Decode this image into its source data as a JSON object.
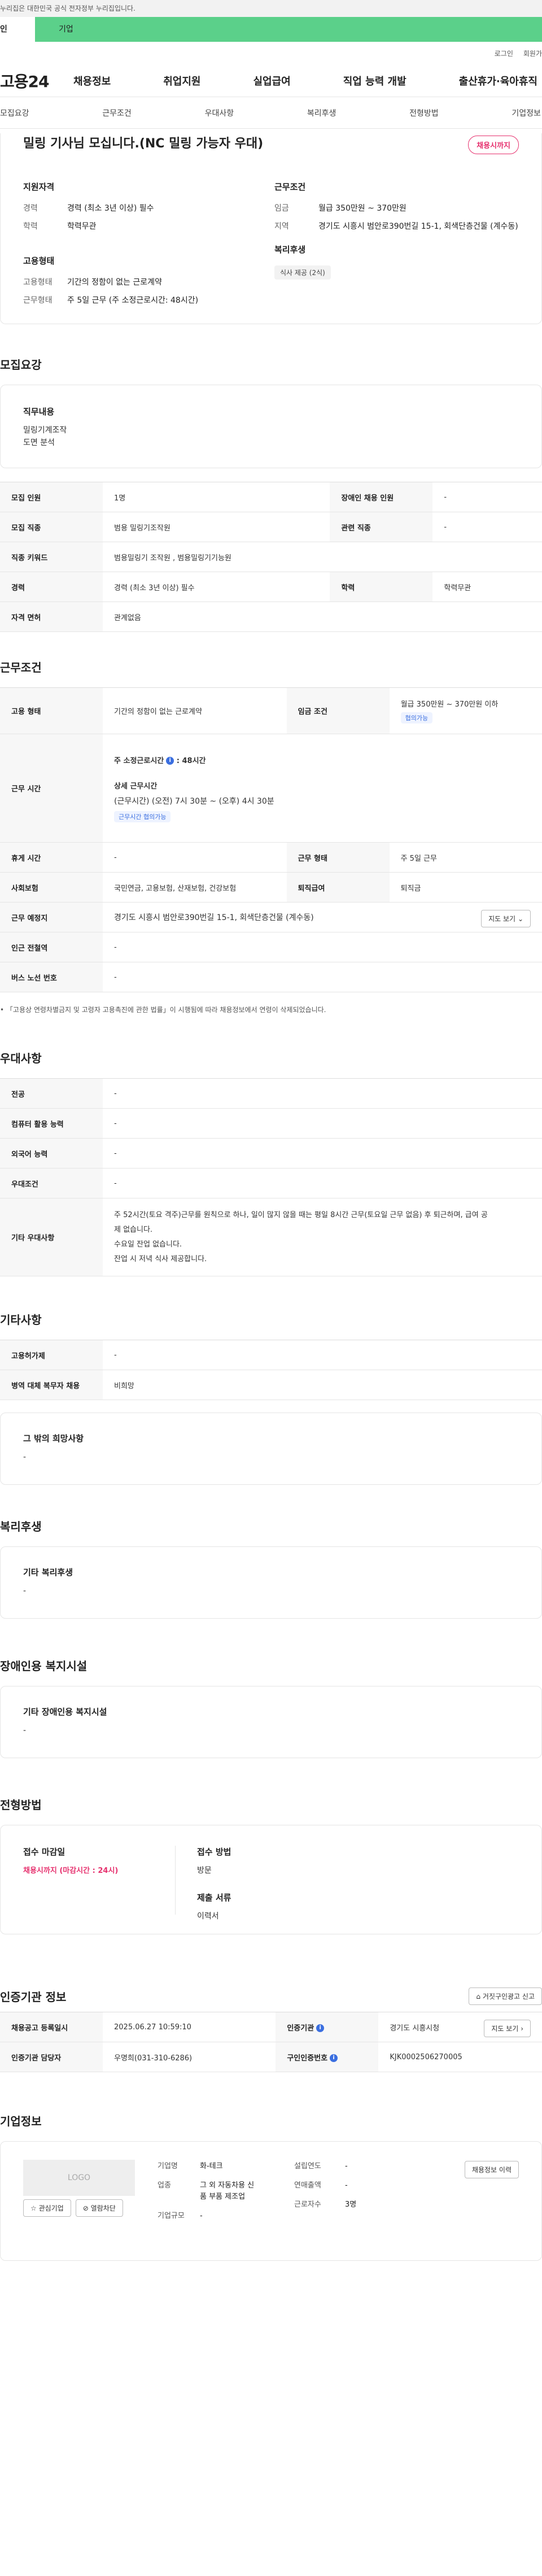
{
  "gov_banner": "누리집은 대한민국 공식 전자정부 누리집입니다.",
  "top_tabs": {
    "person": "인",
    "company": "기업"
  },
  "util": {
    "login": "로그인",
    "join": "회원가"
  },
  "logo": "고용24",
  "gnb": [
    "채용정보",
    "취업지원",
    "실업급여",
    "직업 능력 개발",
    "출산휴가·육아휴직"
  ],
  "anchors": [
    "모집요강",
    "근무조건",
    "우대사항",
    "복리후생",
    "전형방법",
    "기업정보"
  ],
  "summary": {
    "title": "밀링 기사님 모십니다.(NC 밀링 가능자 우대)",
    "dday": "채용시까지",
    "qual_h": "지원자격",
    "career_k": "경력",
    "career_v": "경력 (최소 3년 이상) 필수",
    "edu_k": "학력",
    "edu_v": "학력무관",
    "emp_h": "고용형태",
    "emp_k": "고용형태",
    "emp_v": "기간의 정함이 없는 근로계약",
    "work_k": "근무형태",
    "work_v": "주 5일 근무 (주 소정근로시간: 48시간)",
    "cond_h": "근무조건",
    "wage_k": "임금",
    "wage_v": "월급 350만원 ~ 370만원",
    "area_k": "지역",
    "area_v": "경기도 시흥시 범안로390번길 15-1, 회색단층건물 (계수동)",
    "welfare_h": "복리후생",
    "welfare_chip": "식사 제공 (2식)"
  },
  "recruit": {
    "title": "모집요강",
    "duty_h": "직무내용",
    "duty_lines": [
      "밀링기계조작",
      "도면 분석"
    ],
    "rows": {
      "count_k": "모집 인원",
      "count_v": "1명",
      "disabled_k": "장애인 채용 인원",
      "disabled_v": "-",
      "job_k": "모집 직종",
      "job_v": "범용 밀링기조작원",
      "related_k": "관련 직종",
      "related_v": "-",
      "kw_k": "직종 키워드",
      "kw_v": "범용밀링기 조작원 , 범용밀링기기능원",
      "career_k": "경력",
      "career_v": "경력 (최소 3년 이상) 필수",
      "edu_k": "학력",
      "edu_v": "학력무관",
      "license_k": "자격 면허",
      "license_v": "관계없음"
    }
  },
  "conditions": {
    "title": "근무조건",
    "emp_k": "고용 형태",
    "emp_v": "기간의 정함이 없는 근로계약",
    "wage_k": "임금 조건",
    "wage_v": "월급 350만원 ~ 370만원 이하",
    "wage_chip": "협의가능",
    "hours_k": "근무 시간",
    "weekly": "주 소정근로시간",
    "weekly_v": ": 48시간",
    "detail_h": "상세 근무시간",
    "detail_v": "(근무시간) (오전) 7시 30분 ~ (오후) 4시 30분",
    "detail_chip": "근무시간 협의가능",
    "holiday_k": "휴게 시간",
    "holiday_v": "-",
    "form_k": "근무 형태",
    "form_v": "주 5일 근무",
    "ins_k": "사회보험",
    "ins_v": "국민연금, 고용보험, 산재보험, 건강보험",
    "retire_k": "퇴직급여",
    "retire_v": "퇴직금",
    "place_k": "근무 예정지",
    "place_v": "경기도 시흥시 범안로390번길 15-1, 회색단층건물 (계수동)",
    "map_btn": "지도 보기",
    "station_k": "인근 전철역",
    "station_v": "-",
    "bus_k": "버스 노선 번호",
    "bus_v": "-",
    "note": "「고용상 연령차별금지 및 고령자 고용촉진에 관한 법률」이 시행됨에 따라 채용정보에서 연령이 삭제되었습니다."
  },
  "prefer": {
    "title": "우대사항",
    "major_k": "전공",
    "major_v": "-",
    "pc_k": "컴퓨터 활용 능력",
    "pc_v": "-",
    "lang_k": "외국어 능력",
    "lang_v": "-",
    "cond_k": "우대조건",
    "cond_v": "-",
    "etc_k": "기타 우대사항",
    "etc_lines": [
      "주 52시간(토요 격주)근무를 원칙으로 하나, 일이 많지 않을 때는 평일 8시간 근무(토요일 근무 없음) 후 퇴근하며, 급여 공",
      "제 없습니다.",
      "수요일 잔업 없습니다.",
      "잔업 시 저녁 식사 제공합니다."
    ]
  },
  "etc": {
    "title": "기타사항",
    "subsidy_k": "고용허가제",
    "subsidy_v": "-",
    "military_k": "병역 대체 복무자 채용",
    "military_v": "비희망",
    "hope_h": "그 밖의 희망사항",
    "hope_v": "-"
  },
  "welfare": {
    "title": "복리후생",
    "h": "기타 복리후생",
    "v": "-"
  },
  "facility": {
    "title": "장애인용 복지시설",
    "h": "기타 장애인용 복지시설",
    "v": "-"
  },
  "process": {
    "title": "전형방법",
    "deadline_h": "접수 마감일",
    "deadline_v": "채용시까지 (마감시간 : 24시)",
    "method_h": "접수 방법",
    "method_v": "방문",
    "docs_h": "제출 서류",
    "docs_v": "이력서"
  },
  "agency": {
    "title": "인증기관 정보",
    "report_btn": "거짓구인광고 신고",
    "reg_k": "채용공고 등록일시",
    "reg_v": "2025.06.27 10:59:10",
    "org_k": "인증기관",
    "org_v": "경기도 시흥시청",
    "map_btn": "지도 보기",
    "mgr_k": "인증기관 담당자",
    "mgr_v": "우명희(031-310-6286)",
    "no_k": "구인인증번호",
    "no_v": "KJK0002506270005"
  },
  "company": {
    "title": "기업정보",
    "logo": "LOGO",
    "fav_btn": "관심기업",
    "block_btn": "열람차단",
    "name_k": "기업명",
    "name_v": "화-테크",
    "ind_k": "업종",
    "ind_v1": "그 외 자동차용 신",
    "ind_v2": "품 부품 제조업",
    "size_k": "기업규모",
    "size_v": "-",
    "year_k": "설립연도",
    "year_v": "-",
    "sales_k": "연매출액",
    "sales_v": "-",
    "emp_k": "근로자수",
    "emp_v": "3명",
    "history_btn": "채용정보 이력"
  }
}
